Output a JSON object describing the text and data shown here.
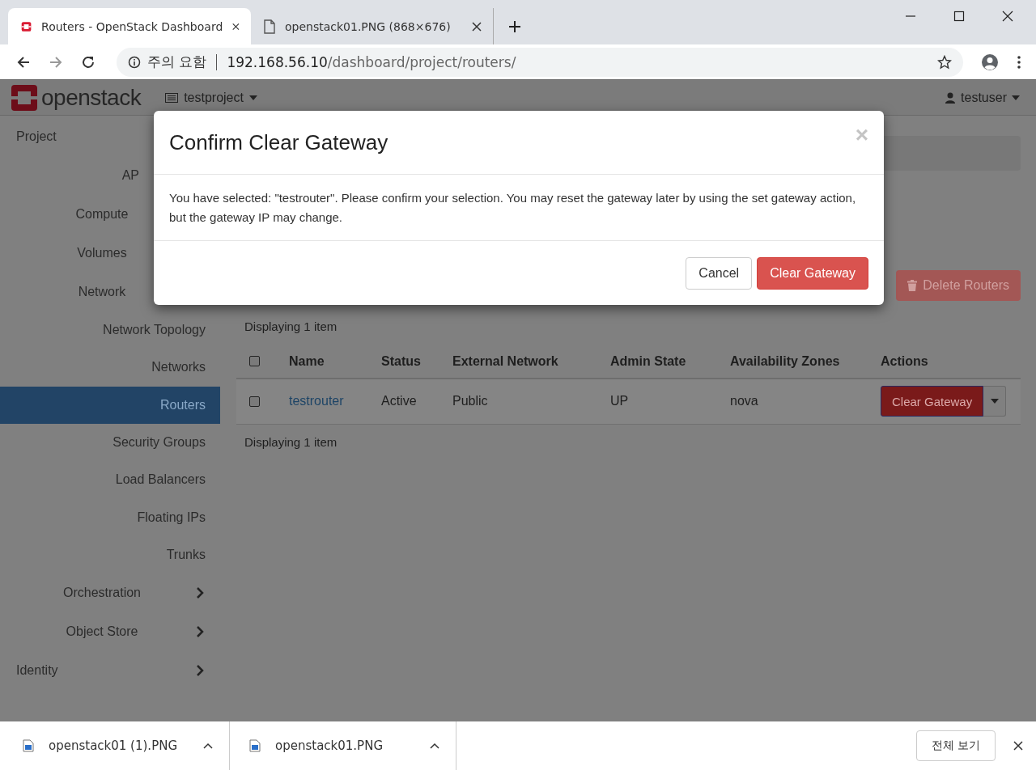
{
  "browser": {
    "tabs": [
      {
        "title": "Routers - OpenStack Dashboard",
        "kind": "site",
        "selected": true
      },
      {
        "title": "openstack01.PNG (868×676)",
        "kind": "file",
        "selected": false
      }
    ],
    "address": {
      "security": "주의 요함",
      "host": "192.168.56.10",
      "path": "/dashboard/project/routers/"
    }
  },
  "header": {
    "logo": "openstack",
    "project": "testproject",
    "user": "testuser"
  },
  "sidebar": {
    "items": [
      {
        "label": "Project",
        "children": [
          {
            "label": "AP"
          },
          {
            "label": "Compute"
          },
          {
            "label": "Volumes"
          },
          {
            "label": "Network",
            "children": [
              {
                "label": "Network Topology",
                "selected": false
              },
              {
                "label": "Networks",
                "selected": false
              },
              {
                "label": "Routers",
                "selected": true
              },
              {
                "label": "Security Groups",
                "selected": false
              },
              {
                "label": "Load Balancers",
                "selected": false
              },
              {
                "label": "Floating IPs",
                "selected": false
              },
              {
                "label": "Trunks",
                "selected": false
              }
            ]
          },
          {
            "label": "Orchestration",
            "expanded": false
          },
          {
            "label": "Object Store",
            "expanded": false
          }
        ]
      },
      {
        "label": "Identity",
        "expanded": false
      }
    ]
  },
  "toolbar": {
    "buttons": [
      {
        "label": "Delete Routers",
        "kind": "danger",
        "disabled": true
      }
    ]
  },
  "table": {
    "summary_top": "Displaying 1 item",
    "select_all_checked": false,
    "columns": [
      "Name",
      "Status",
      "External Network",
      "Admin State",
      "Availability Zones",
      "Actions"
    ],
    "rows": [
      {
        "checked": false,
        "name": "testrouter",
        "status": "Active",
        "external_network": "Public",
        "admin_state": "UP",
        "availability_zones": "nova",
        "action": "Clear Gateway"
      }
    ],
    "summary_bottom": "Displaying 1 item"
  },
  "modal": {
    "title": "Confirm Clear Gateway",
    "close": "×",
    "message": "You have selected: \"testrouter\". Please confirm your selection. You may reset the gateway later by using the set gateway action, but the gateway IP may change.",
    "buttons": [
      {
        "label": "Cancel",
        "kind": "default"
      },
      {
        "label": "Clear Gateway",
        "kind": "danger"
      }
    ]
  },
  "downloads": {
    "items": [
      {
        "name": "openstack01 (1).PNG"
      },
      {
        "name": "openstack01.PNG"
      }
    ],
    "show_all": "전체 보기"
  }
}
